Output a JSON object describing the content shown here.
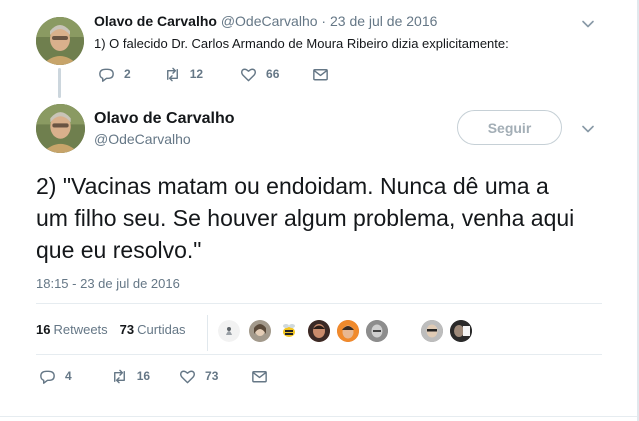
{
  "parent_tweet": {
    "name": "Olavo de Carvalho",
    "handle": "@OdeCarvalho",
    "separator": "·",
    "date": "23 de jul de 2016",
    "text": "1) O falecido Dr. Carlos Armando de Moura Ribeiro dizia explicitamente:",
    "replies": "2",
    "retweets": "12",
    "likes": "66"
  },
  "main_tweet": {
    "name": "Olavo de Carvalho",
    "handle": "@OdeCarvalho",
    "follow_label": "Seguir",
    "text": "2) \"Vacinas matam ou endoidam. Nunca dê uma a um filho seu. Se houver algum problema, venha aqui que eu resolvo.\"",
    "timestamp": "18:15 - 23 de jul de 2016",
    "retweets_count": "16",
    "retweets_label": "Retweets",
    "likes_count": "73",
    "likes_label": "Curtidas",
    "replies": "4",
    "retweets": "16",
    "likes": "73"
  },
  "colors": {
    "text": "#14171a",
    "secondary": "#657786",
    "border": "#e6ecf0"
  },
  "icons": [
    "reply-icon",
    "retweet-icon",
    "like-icon",
    "direct-message-icon",
    "chevron-down-icon"
  ]
}
